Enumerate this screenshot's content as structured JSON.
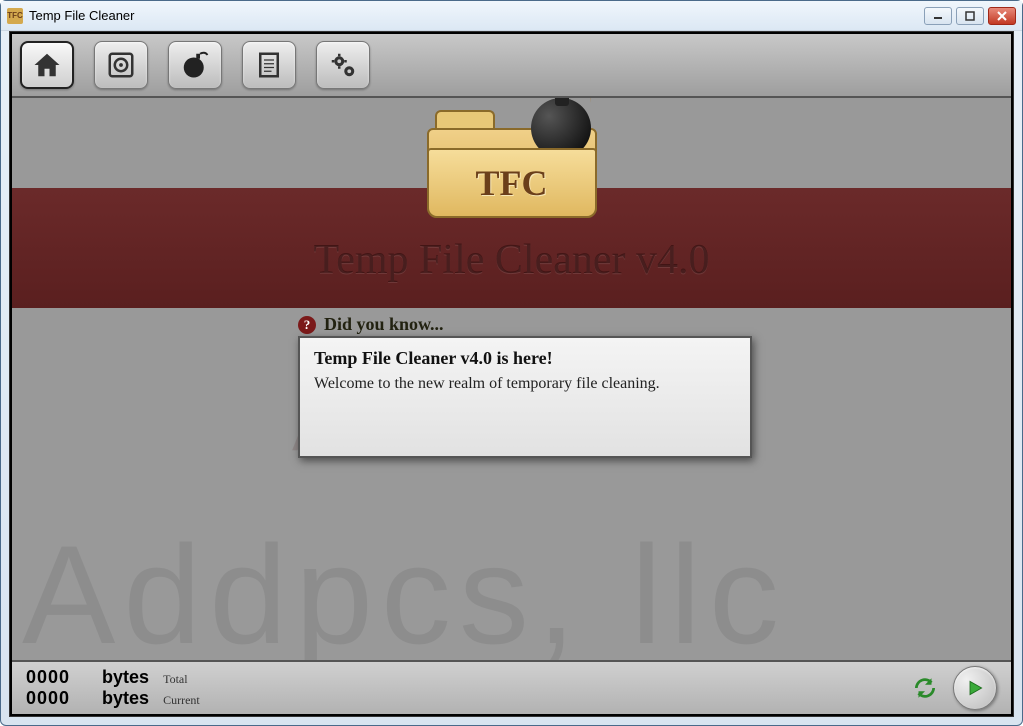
{
  "window": {
    "title": "Temp File Cleaner",
    "icon_label": "TFC"
  },
  "toolbar": {
    "items": [
      {
        "name": "home",
        "active": true
      },
      {
        "name": "drives",
        "active": false
      },
      {
        "name": "clean",
        "active": false
      },
      {
        "name": "logs",
        "active": false
      },
      {
        "name": "settings",
        "active": false
      }
    ]
  },
  "logo": {
    "folder_label": "TFC"
  },
  "main": {
    "app_title": "Temp File Cleaner v4.0",
    "company_watermark_small": "ADDPCS, LLC",
    "company_watermark_large": "Addpcs, llc"
  },
  "did_you_know": {
    "label": "Did you know...",
    "heading": "Temp File Cleaner v4.0 is here!",
    "body": "Welcome to the new realm of temporary file cleaning."
  },
  "status": {
    "total_value": "0000",
    "total_unit": "bytes",
    "total_label": "Total",
    "current_value": "0000",
    "current_unit": "bytes",
    "current_label": "Current"
  }
}
